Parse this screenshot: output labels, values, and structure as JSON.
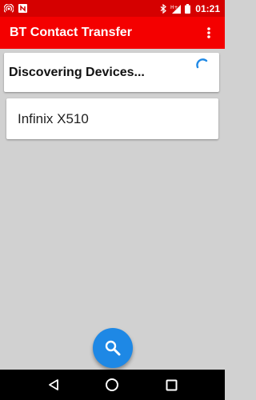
{
  "status_bar": {
    "time": "01:21",
    "icons": [
      "hotspot-icon",
      "n-icon",
      "bluetooth-icon",
      "hplus-signal-icon",
      "battery-icon"
    ],
    "network_label": "H+"
  },
  "app_bar": {
    "title": "BT Contact Transfer",
    "overflow_icon": "more-vert-icon"
  },
  "discover_card": {
    "text": "Discovering Devices..."
  },
  "devices": [
    {
      "name": "Infinix X510"
    }
  ],
  "fab": {
    "icon": "search-icon",
    "color": "#1e88e5"
  },
  "nav_bar": {
    "icons": [
      "back-icon",
      "home-icon",
      "recents-icon"
    ]
  },
  "colors": {
    "status_bar": "#d50000",
    "app_bar": "#f40000",
    "background": "#d1d1d1",
    "accent": "#1e88e5"
  }
}
